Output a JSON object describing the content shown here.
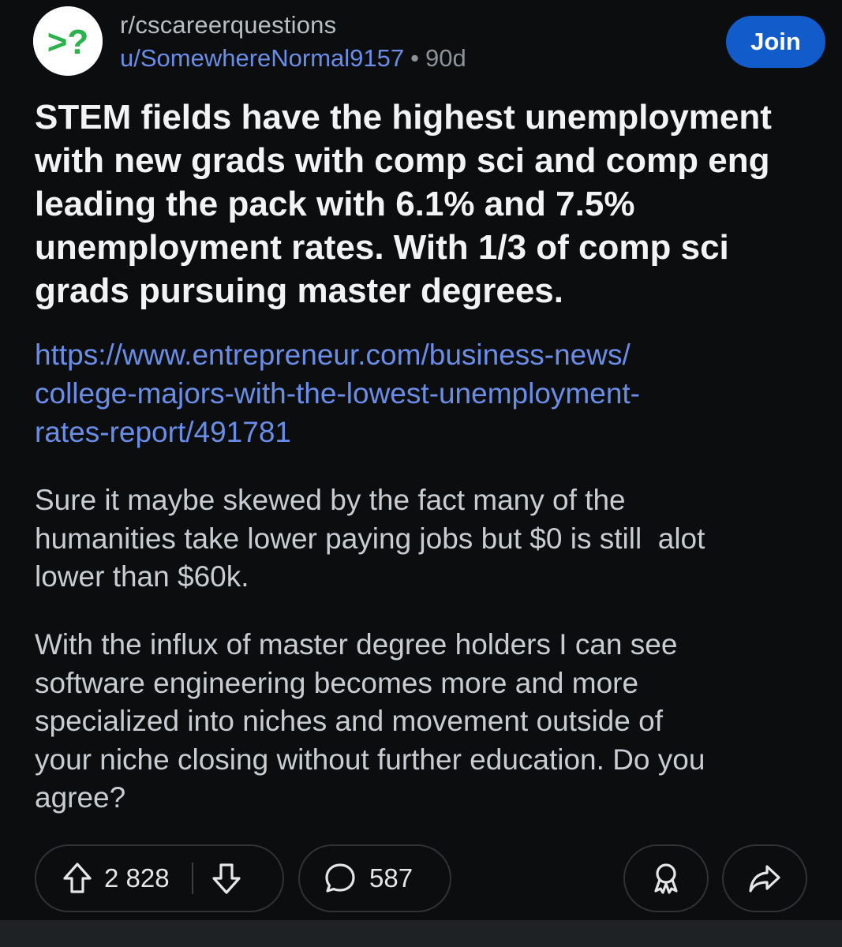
{
  "header": {
    "subreddit": "r/cscareerquestions",
    "username": "u/SomewhereNormal9157",
    "separator": "•",
    "age": "90d",
    "join_label": "Join",
    "avatar_text": ">?",
    "avatar_colors": {
      "symbol": "#2cb24a",
      "background": "#ffffff"
    }
  },
  "post": {
    "title": "STEM fields have the highest unemployment with new grads with comp sci and comp eng leading the pack with 6.1% and 7.5% unemployment rates. With 1/3 of comp sci grads pursuing master degrees.",
    "link_lines": [
      "https://www.entrepreneur.com/business-news/",
      "college-majors-with-the-lowest-unemployment-",
      "rates-report/491781"
    ],
    "paragraph1_lines": [
      "Sure it maybe skewed by the fact many of the",
      "humanities take lower paying jobs but $0 is still  alot",
      "lower than $60k."
    ],
    "paragraph2_lines": [
      "With the influx of master degree holders I can see",
      "software engineering becomes more and more",
      "specialized into niches and movement outside of",
      "your niche closing without further education. Do you",
      "agree?"
    ]
  },
  "actions": {
    "upvotes": "2 828",
    "comments": "587",
    "icons": [
      "upvote-icon",
      "downvote-icon",
      "comment-icon",
      "award-icon",
      "share-icon"
    ]
  },
  "colors": {
    "background": "#0b0d0f",
    "link": "#6a8ee8",
    "join_button": "#115bca",
    "title_text": "#f2f3f5",
    "body_text": "#c9cdd1"
  }
}
